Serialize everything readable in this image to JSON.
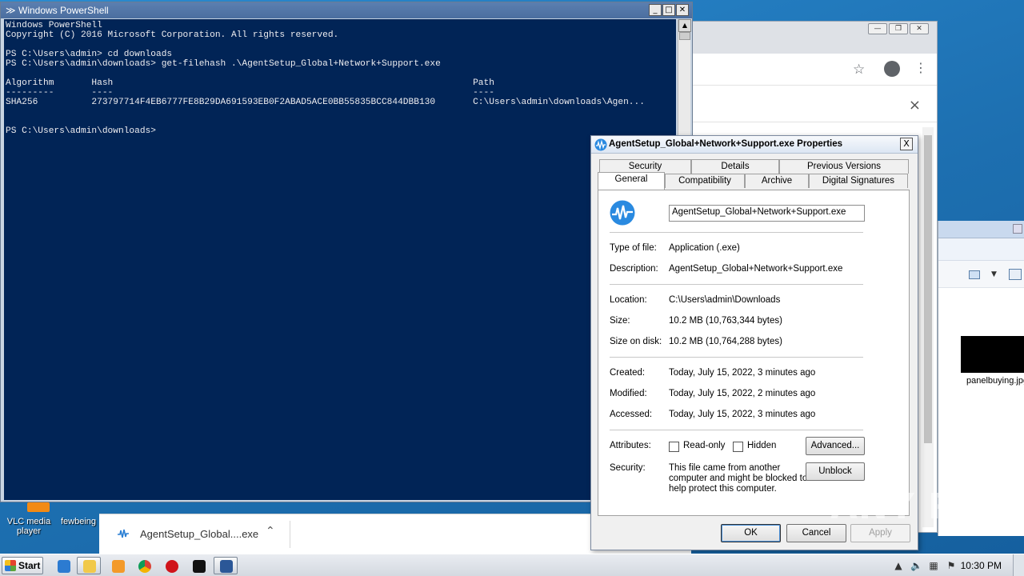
{
  "powershell": {
    "title": "Windows PowerShell",
    "lines": [
      "Windows PowerShell",
      "Copyright (C) 2016 Microsoft Corporation. All rights reserved.",
      "",
      "PS C:\\Users\\admin> cd downloads",
      "PS C:\\Users\\admin\\downloads> get-filehash .\\AgentSetup_Global+Network+Support.exe",
      "",
      "Algorithm       Hash                                                                   Path",
      "---------       ----                                                                   ----",
      "SHA256          273797714F4EB6777FE8B29DA691593EB0F2ABAD5ACE0BB55835BCC844DBB130       C:\\Users\\admin\\downloads\\Agen...",
      "",
      "",
      "PS C:\\Users\\admin\\downloads>"
    ]
  },
  "chrome": {
    "close_symbol": "×"
  },
  "download_bar": {
    "file_name": "AgentSetup_Global....exe",
    "chevron": "^"
  },
  "desktop_icons": [
    {
      "label_line1": "VLC media",
      "label_line2": "player"
    },
    {
      "label_line1": "fewbeing",
      "label_line2": ""
    }
  ],
  "explorer": {
    "file_name": "panelbuying.jpg"
  },
  "properties": {
    "title": "AgentSetup_Global+Network+Support.exe Properties",
    "tabs_row1": [
      "Security",
      "Details",
      "Previous Versions"
    ],
    "tabs_row2": [
      "General",
      "Compatibility",
      "Archive",
      "Digital Signatures"
    ],
    "active_tab": "General",
    "file_name": "AgentSetup_Global+Network+Support.exe",
    "type_label": "Type of file:",
    "type_value": "Application (.exe)",
    "desc_label": "Description:",
    "desc_value": "AgentSetup_Global+Network+Support.exe",
    "location_label": "Location:",
    "location_value": "C:\\Users\\admin\\Downloads",
    "size_label": "Size:",
    "size_value": "10.2 MB (10,763,344 bytes)",
    "disk_label": "Size on disk:",
    "disk_value": "10.2 MB (10,764,288 bytes)",
    "created_label": "Created:",
    "created_value": "Today, July 15, 2022, 3 minutes ago",
    "modified_label": "Modified:",
    "modified_value": "Today, July 15, 2022, 2 minutes ago",
    "accessed_label": "Accessed:",
    "accessed_value": "Today, July 15, 2022, 3 minutes ago",
    "attributes_label": "Attributes:",
    "readonly_label": "Read-only",
    "hidden_label": "Hidden",
    "advanced_button": "Advanced...",
    "security_label": "Security:",
    "security_text_1": "This file came from another",
    "security_text_2": "computer and might be blocked to",
    "security_text_3": "help protect this computer.",
    "unblock_button": "Unblock",
    "ok_button": "OK",
    "cancel_button": "Cancel",
    "apply_button": "Apply",
    "close_symbol": "X"
  },
  "watermark": "ANY RUN",
  "taskbar": {
    "start_label": "Start",
    "clock": "10:30 PM"
  }
}
